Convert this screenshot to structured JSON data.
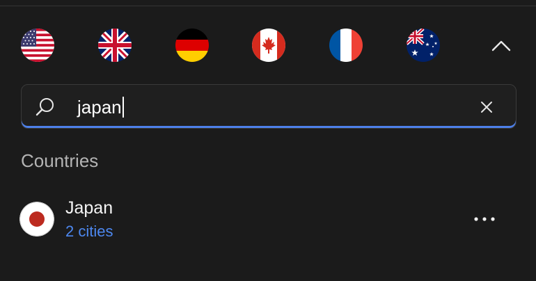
{
  "quick_flags": [
    {
      "country": "United States",
      "icon": "us-flag-icon"
    },
    {
      "country": "United Kingdom",
      "icon": "uk-flag-icon"
    },
    {
      "country": "Germany",
      "icon": "germany-flag-icon"
    },
    {
      "country": "Canada",
      "icon": "canada-flag-icon"
    },
    {
      "country": "France",
      "icon": "france-flag-icon"
    },
    {
      "country": "Australia",
      "icon": "australia-flag-icon"
    }
  ],
  "search": {
    "value": "japan",
    "icon": "search-icon",
    "clear_icon": "close-icon"
  },
  "results": {
    "heading": "Countries",
    "items": [
      {
        "name": "Japan",
        "subtitle": "2 cities",
        "icon": "japan-flag-icon"
      }
    ]
  },
  "colors": {
    "background": "#1b1b1b",
    "accent": "#4d80ea",
    "link": "#4d88f0",
    "heading": "#b4b4b4"
  }
}
